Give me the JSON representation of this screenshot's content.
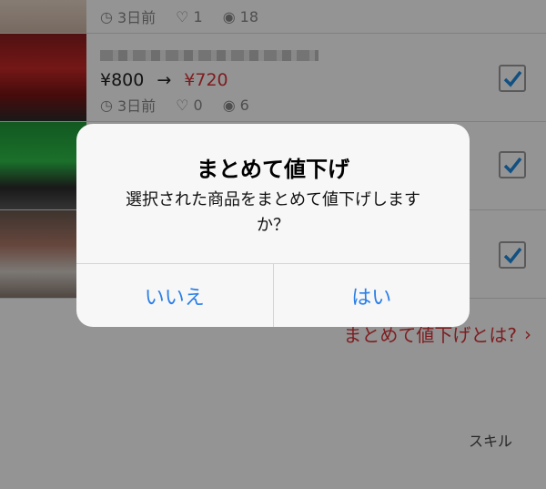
{
  "rows": [
    {
      "time": "3日前",
      "likes": "1",
      "views": "18"
    },
    {
      "price_old": "¥800",
      "arrow": "→",
      "price_new": "¥720",
      "time": "3日前",
      "likes": "0",
      "views": "6"
    }
  ],
  "partial_label": "スキル",
  "link_text": "まとめて値下げとは?",
  "dialog": {
    "title": "まとめて値下げ",
    "message": "選択された商品をまとめて値下げしますか？",
    "no_label": "いいえ",
    "yes_label": "はい"
  },
  "colors": {
    "accent_red": "#d9353a",
    "ios_blue": "#2a7fe8",
    "check_blue": "#1f8be0"
  }
}
